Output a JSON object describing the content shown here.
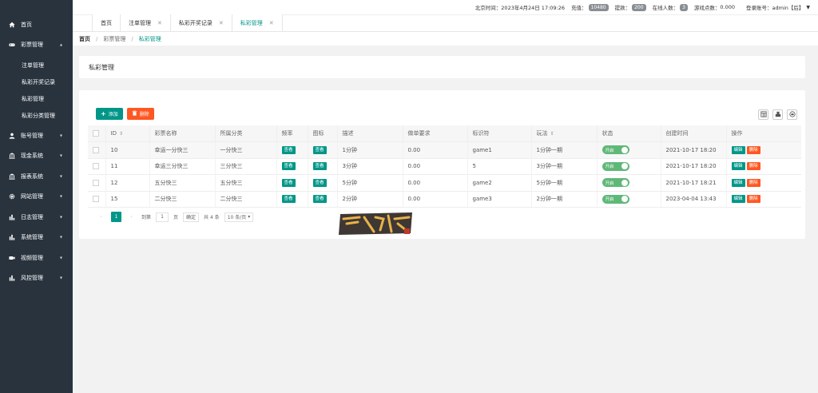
{
  "sidebar": {
    "items": [
      {
        "label": "首页",
        "icon": "home-icon"
      },
      {
        "label": "彩票管理",
        "icon": "gamepad-icon",
        "expanded": true,
        "children": [
          "注单管理",
          "私彩开奖记录",
          "私彩管理",
          "私彩分类管理"
        ]
      },
      {
        "label": "账号管理",
        "icon": "user-icon"
      },
      {
        "label": "现金系统",
        "icon": "bank-icon"
      },
      {
        "label": "报表系统",
        "icon": "bank-icon"
      },
      {
        "label": "网站管理",
        "icon": "gear-icon"
      },
      {
        "label": "日志管理",
        "icon": "bar-chart-icon"
      },
      {
        "label": "系统管理",
        "icon": "bar-chart-icon"
      },
      {
        "label": "视频管理",
        "icon": "video-icon"
      },
      {
        "label": "风控管理",
        "icon": "bar-chart-icon"
      }
    ]
  },
  "topbar": {
    "time_label": "北京时间：",
    "time": "2023年4月24日 17:09:26",
    "recharge_label": "充值：",
    "recharge": "10480",
    "withdraw_label": "提款：",
    "withdraw": "200",
    "online_label": "在线人数：",
    "online": "3",
    "balance_label": "游戏点数：",
    "balance": "0.000",
    "account_label": "登录账号：",
    "account": "admin【后】"
  },
  "tabs": [
    {
      "label": "首页",
      "closable": false,
      "active": false
    },
    {
      "label": "注单管理",
      "closable": true,
      "active": false
    },
    {
      "label": "私彩开奖记录",
      "closable": true,
      "active": false
    },
    {
      "label": "私彩管理",
      "closable": true,
      "active": true
    }
  ],
  "breadcrumb": [
    "首页",
    "彩票管理",
    "私彩管理"
  ],
  "page_title": "私彩管理",
  "toolbar": {
    "add_label": "添加",
    "delete_label": "删除"
  },
  "table": {
    "headers": [
      "",
      "ID",
      "彩票名称",
      "所属分类",
      "频率",
      "图标",
      "描述",
      "做单要求",
      "标识符",
      "玩法",
      "状态",
      "创建时间",
      "操作"
    ],
    "view_label": "查看",
    "edit_label": "编辑",
    "delete_label": "删除",
    "switch_label": "开启",
    "rows": [
      {
        "id": "10",
        "name": "幸运一分快三",
        "category": "一分快三",
        "desc": "1分钟",
        "requirement": "0.00",
        "code": "game1",
        "play": "1分钟一期",
        "created": "2021-10-17 18:20"
      },
      {
        "id": "11",
        "name": "幸运三分快三",
        "category": "三分快三",
        "desc": "3分钟",
        "requirement": "0.00",
        "code": "5",
        "play": "3分钟一期",
        "created": "2021-10-17 18:20"
      },
      {
        "id": "12",
        "name": "五分快三",
        "category": "五分快三",
        "desc": "5分钟",
        "requirement": "0.00",
        "code": "game2",
        "play": "5分钟一期",
        "created": "2021-10-17 18:21"
      },
      {
        "id": "15",
        "name": "二分快三",
        "category": "二分快三",
        "desc": "2分钟",
        "requirement": "0.00",
        "code": "game3",
        "play": "2分钟一期",
        "created": "2023-04-04 13:43"
      }
    ]
  },
  "pager": {
    "current": "1",
    "goto_label": "到第",
    "page_input": "1",
    "page_unit": "页",
    "confirm_label": "确定",
    "total": "共 4 条",
    "page_size": "10 条/页"
  },
  "watermark": {
    "text": "南鱼科技"
  },
  "colors": {
    "sidebar": "#28333e",
    "accent": "#009688",
    "danger": "#ff5722",
    "switch_on": "#5fb878"
  }
}
